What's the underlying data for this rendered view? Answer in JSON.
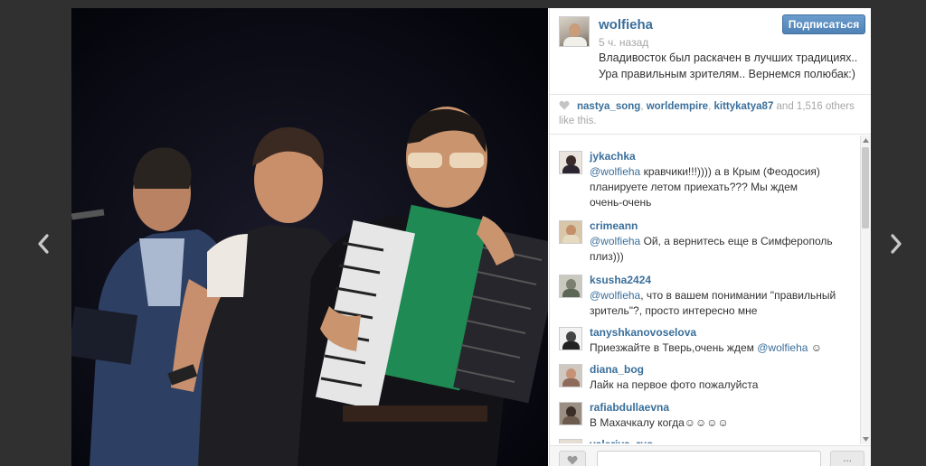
{
  "nav": {
    "prev_icon": "chevron-left-icon",
    "next_icon": "chevron-right-icon"
  },
  "post": {
    "author": "wolfieha",
    "time": "5 ч. назад",
    "caption_lines": [
      "Владивосток был раскачен в лучших традициях..",
      "Ура правильным зрителям.. Вернемся полюбак:)"
    ],
    "follow_label": "Подписаться"
  },
  "likes": {
    "users": [
      "nastya_song",
      "worldempire",
      "kittykatya87"
    ],
    "sep1": ", ",
    "sep2": ", ",
    "and_text": " and ",
    "count": "1,516",
    "others_text": " others like this."
  },
  "comments": [
    {
      "user": "jykachka",
      "mention": "@wolfieha",
      "lines": [
        "кравчики!!!)))) а в Крым (Феодосия)",
        "планируете летом приехать??? Мы ждем",
        "очень-очень"
      ]
    },
    {
      "user": "crimeann",
      "mention": "@wolfieha",
      "lines": [
        "Ой, а вернитесь еще в Симферополь",
        "плиз)))"
      ]
    },
    {
      "user": "ksusha2424",
      "mention": "@wolfieha",
      "lines": [
        ", что в вашем понимании \"правильный",
        "зритель\"?, просто интересно мне"
      ]
    },
    {
      "user": "tanyshkanovoselova",
      "lines": [
        "Приезжайте в Тверь,очень ждем "
      ],
      "mention_after": "@wolfieha",
      "emoji": "☺"
    },
    {
      "user": "diana_bog",
      "lines": [
        "Лайк на первое фото пожалуйста"
      ]
    },
    {
      "user": "rafiabdullaevna",
      "lines": [
        "В Махачкалу когда☺☺☺☺"
      ]
    },
    {
      "user": "valeriya_rus",
      "lines": []
    }
  ],
  "comment_bar": {
    "placeholder": "",
    "more_label": "..."
  },
  "colors": {
    "link": "#3a6f9b",
    "follow": "#5588bb",
    "backdrop": "#303030"
  }
}
